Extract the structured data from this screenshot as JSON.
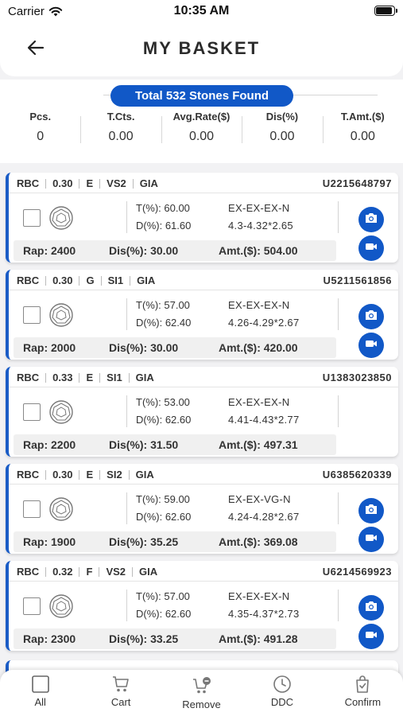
{
  "status_bar": {
    "carrier": "Carrier",
    "time": "10:35 AM"
  },
  "header": {
    "title": "MY BASKET"
  },
  "summary": {
    "found_text": "Total 532 Stones Found",
    "stats": [
      {
        "label": "Pcs.",
        "value": "0"
      },
      {
        "label": "T.Cts.",
        "value": "0.00"
      },
      {
        "label": "Avg.Rate($)",
        "value": "0.00"
      },
      {
        "label": "Dis(%)",
        "value": "0.00"
      },
      {
        "label": "T.Amt.($)",
        "value": "0.00"
      }
    ]
  },
  "stones": [
    {
      "shape": "RBC",
      "carat": "0.30",
      "color": "E",
      "clarity": "VS2",
      "lab": "GIA",
      "id": "U2215648797",
      "t_pct": "T(%): 60.00",
      "d_pct": "D(%): 61.60",
      "cut": "EX-EX-EX-N",
      "meas": "4.3-4.32*2.65",
      "rap": "Rap: 2400",
      "dis": "Dis(%): 30.00",
      "amt": "Amt.($): 504.00",
      "media": true
    },
    {
      "shape": "RBC",
      "carat": "0.30",
      "color": "G",
      "clarity": "SI1",
      "lab": "GIA",
      "id": "U5211561856",
      "t_pct": "T(%): 57.00",
      "d_pct": "D(%): 62.40",
      "cut": "EX-EX-EX-N",
      "meas": "4.26-4.29*2.67",
      "rap": "Rap: 2000",
      "dis": "Dis(%): 30.00",
      "amt": "Amt.($): 420.00",
      "media": true
    },
    {
      "shape": "RBC",
      "carat": "0.33",
      "color": "E",
      "clarity": "SI1",
      "lab": "GIA",
      "id": "U1383023850",
      "t_pct": "T(%): 53.00",
      "d_pct": "D(%): 62.60",
      "cut": "EX-EX-EX-N",
      "meas": "4.41-4.43*2.77",
      "rap": "Rap: 2200",
      "dis": "Dis(%): 31.50",
      "amt": "Amt.($): 497.31",
      "media": false
    },
    {
      "shape": "RBC",
      "carat": "0.30",
      "color": "E",
      "clarity": "SI2",
      "lab": "GIA",
      "id": "U6385620339",
      "t_pct": "T(%): 59.00",
      "d_pct": "D(%): 62.60",
      "cut": "EX-EX-VG-N",
      "meas": "4.24-4.28*2.67",
      "rap": "Rap: 1900",
      "dis": "Dis(%): 35.25",
      "amt": "Amt.($): 369.08",
      "media": true
    },
    {
      "shape": "RBC",
      "carat": "0.32",
      "color": "F",
      "clarity": "VS2",
      "lab": "GIA",
      "id": "U6214569923",
      "t_pct": "T(%): 57.00",
      "d_pct": "D(%): 62.60",
      "cut": "EX-EX-EX-N",
      "meas": "4.35-4.37*2.73",
      "rap": "Rap: 2300",
      "dis": "Dis(%): 33.25",
      "amt": "Amt.($): 491.28",
      "media": true
    }
  ],
  "bottom_nav": [
    {
      "label": "All",
      "icon": "checkbox-icon"
    },
    {
      "label": "Cart",
      "icon": "cart-icon"
    },
    {
      "label": "Remove",
      "icon": "remove-cart-icon"
    },
    {
      "label": "DDC",
      "icon": "clock-icon"
    },
    {
      "label": "Confirm",
      "icon": "confirm-bag-icon"
    }
  ],
  "colors": {
    "accent": "#1158c7",
    "card_border": "#1a5cc6",
    "background": "#f2f2f4"
  }
}
